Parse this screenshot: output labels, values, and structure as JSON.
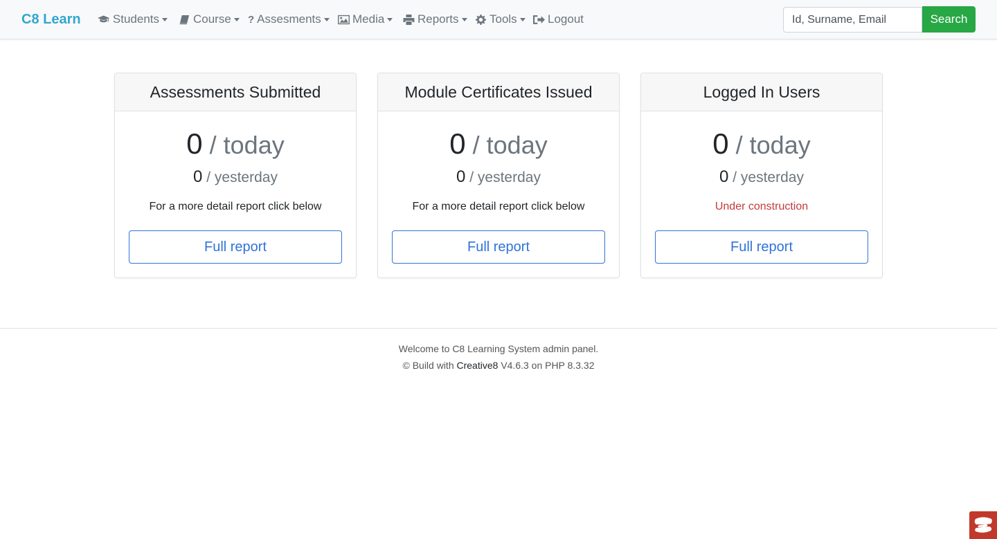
{
  "brand": "C8 Learn",
  "nav": [
    {
      "label": "Students",
      "icon": "graduation-cap-icon",
      "dropdown": true
    },
    {
      "label": "Course",
      "icon": "book-icon",
      "dropdown": true
    },
    {
      "label": "Assesments",
      "icon": "question-icon",
      "dropdown": true
    },
    {
      "label": "Media",
      "icon": "image-icon",
      "dropdown": true
    },
    {
      "label": "Reports",
      "icon": "print-icon",
      "dropdown": true
    },
    {
      "label": "Tools",
      "icon": "gear-icon",
      "dropdown": true
    },
    {
      "label": "Logout",
      "icon": "sign-out-icon",
      "dropdown": false
    }
  ],
  "search": {
    "placeholder": "Id, Surname, Email",
    "button": "Search"
  },
  "cards": [
    {
      "title": "Assessments Submitted",
      "today_count": "0",
      "today_label": "/ today",
      "yesterday_count": "0",
      "yesterday_label": "/ yesterday",
      "note": "For a more detail report click below",
      "button": "Full report"
    },
    {
      "title": "Module Certificates Issued",
      "today_count": "0",
      "today_label": "/ today",
      "yesterday_count": "0",
      "yesterday_label": "/ yesterday",
      "note": "For a more detail report click below",
      "button": "Full report"
    },
    {
      "title": "Logged In Users",
      "today_count": "0",
      "today_label": "/ today",
      "yesterday_count": "0",
      "yesterday_label": "/ yesterday",
      "note": "Under construction",
      "button": "Full report"
    }
  ],
  "footer": {
    "line1": "Welcome to C8 Learning System admin panel.",
    "line2_prefix": "© Build with",
    "line2_brand": "Creative8",
    "line2_suffix": "V4.6.3 on PHP 8.3.32"
  },
  "colors": {
    "brand": "#31a7cf",
    "search_button": "#28a745",
    "report_button": "#2f73d8",
    "warning_text": "#c23a3a",
    "corner_widget": "#c0392b"
  }
}
